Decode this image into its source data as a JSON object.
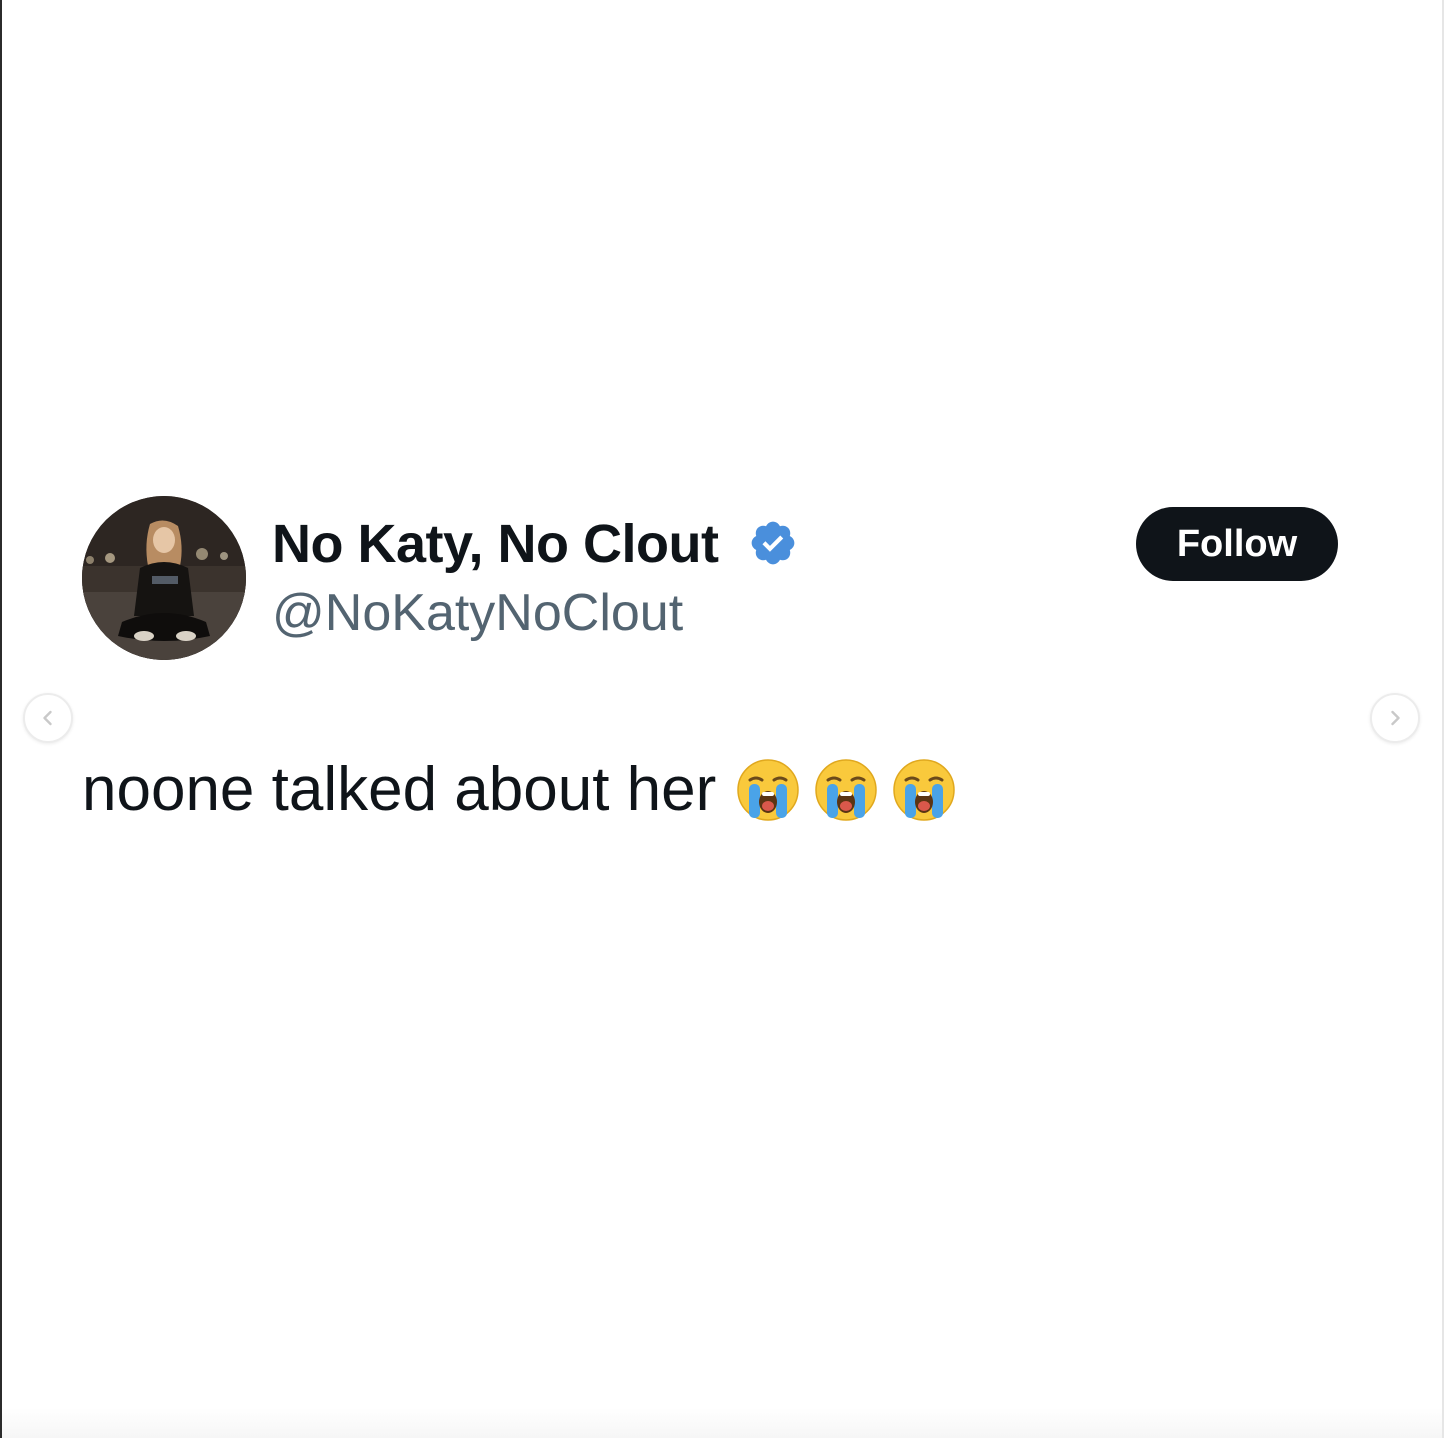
{
  "tweet": {
    "display_name": "No Katy, No Clout",
    "handle": "@NoKatyNoClout",
    "verified": true,
    "follow_label": "Follow",
    "text": "noone talked about her",
    "emojis": [
      "loudly-crying-face",
      "loudly-crying-face",
      "loudly-crying-face"
    ]
  },
  "carousel": {
    "prev_icon": "chevron-left-icon",
    "next_icon": "chevron-right-icon"
  },
  "colors": {
    "name": "#0f1419",
    "handle": "#536471",
    "verified": "#1d9bf0",
    "follow_bg": "#0f1419",
    "follow_text": "#ffffff"
  }
}
